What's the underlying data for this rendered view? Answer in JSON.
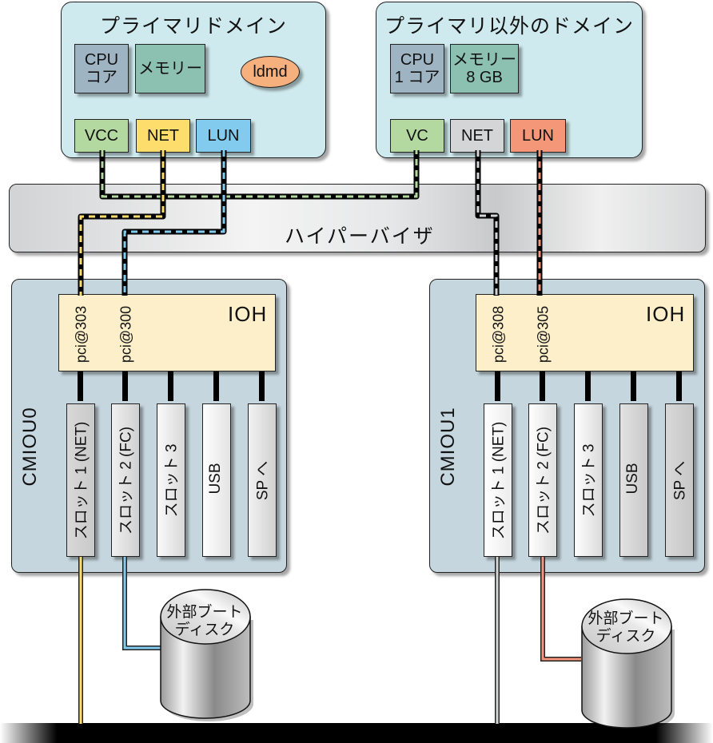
{
  "primary_domain": {
    "title": "プライマリドメイン",
    "cpu_line1": "CPU",
    "cpu_line2": "コア",
    "memory": "メモリー",
    "daemon": "ldmd",
    "ports": {
      "vcc": "VCC",
      "net": "NET",
      "lun": "LUN"
    }
  },
  "non_primary_domain": {
    "title": "プライマリ以外のドメイン",
    "cpu_line1": "CPU",
    "cpu_line2": "1 コア",
    "memory_line1": "メモリー",
    "memory_line2": "8 GB",
    "ports": {
      "vc": "VC",
      "net": "NET",
      "lun": "LUN"
    }
  },
  "hypervisor": {
    "label": "ハイパーバイザ"
  },
  "cmiou": [
    {
      "label": "CMIOU0",
      "ioh_label": "IOH",
      "pci": [
        "pci@303",
        "pci@300"
      ],
      "slots": [
        "スロット 1 (NET)",
        "スロット 2 (FC)",
        "スロット 3",
        "USB",
        "SP へ"
      ]
    },
    {
      "label": "CMIOU1",
      "ioh_label": "IOH",
      "pci": [
        "pci@308",
        "pci@305"
      ],
      "slots": [
        "スロット 1 (NET)",
        "スロット 2 (FC)",
        "スロット 3",
        "USB",
        "SP へ"
      ]
    }
  ],
  "disks": [
    {
      "line1": "外部ブート",
      "line2": "ディスク"
    },
    {
      "line1": "外部ブート",
      "line2": "ディスク"
    }
  ],
  "colors": {
    "vcc_green": "#b3d9a1",
    "net_yellow": "#fddd6b",
    "lun_blue": "#82cbee",
    "net_gray": "#d4d5d7",
    "lun_red": "#f49678"
  }
}
